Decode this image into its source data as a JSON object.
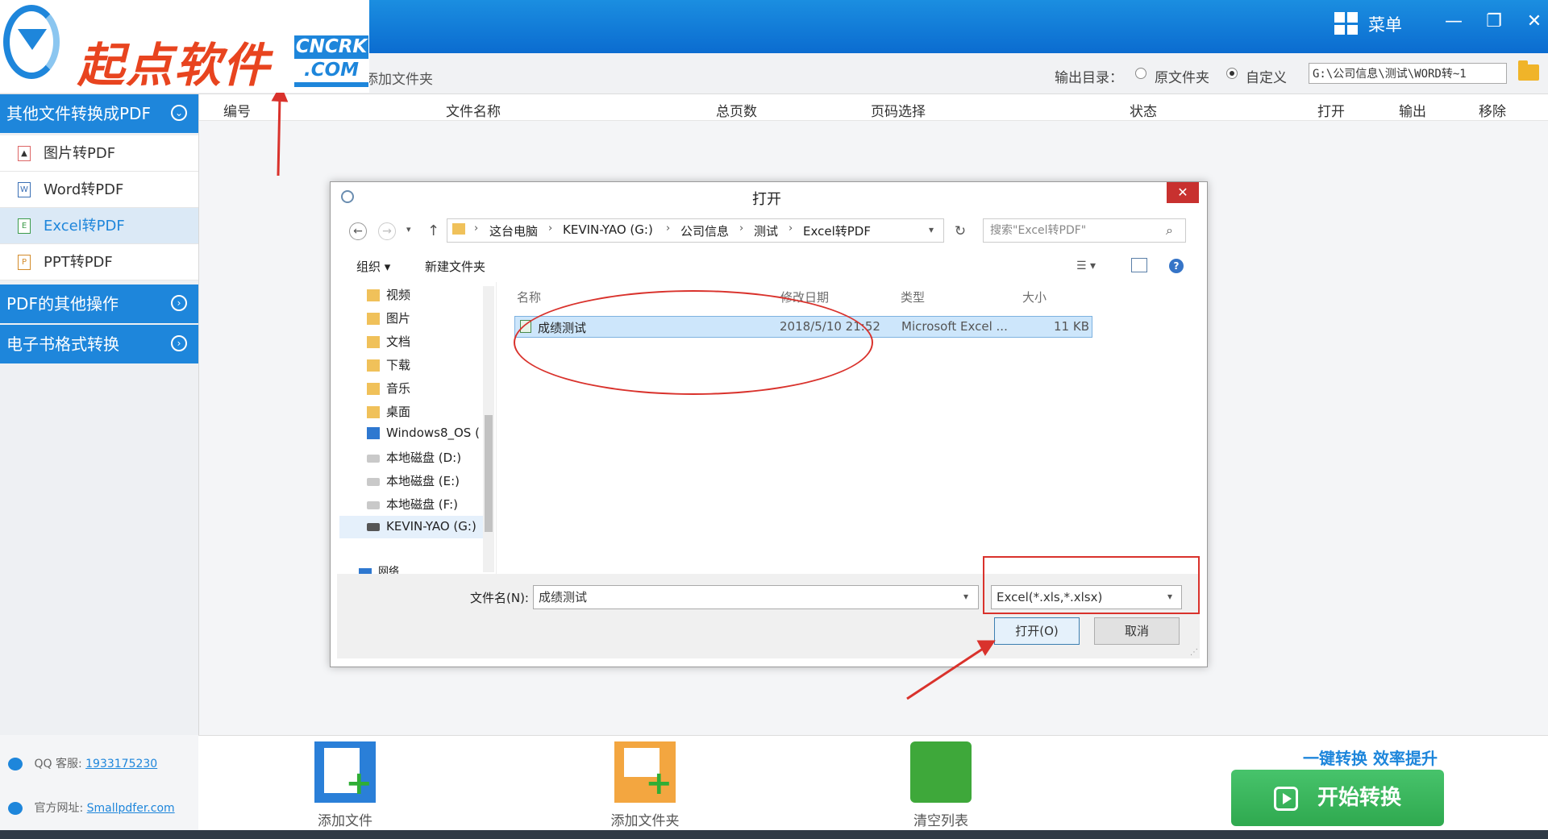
{
  "app": {
    "logo_text": "起点软件",
    "logo_badge_line1": "CNCRK",
    "logo_badge_line2": ".COM",
    "menu_label": "菜单"
  },
  "toolbar": {
    "add_folder": "添加文件夹",
    "output_dir_label": "输出目录：",
    "radio_source": "原文件夹",
    "radio_custom": "自定义",
    "output_path": "G:\\公司信息\\测试\\WORD转~1"
  },
  "table": {
    "columns": [
      "编号",
      "文件名称",
      "总页数",
      "页码选择",
      "状态",
      "打开",
      "输出",
      "移除"
    ]
  },
  "sidebar": {
    "cat1": "其他文件转换成PDF",
    "items": [
      "图片转PDF",
      "Word转PDF",
      "Excel转PDF",
      "PPT转PDF"
    ],
    "cat2": "PDF的其他操作",
    "cat3": "电子书格式转换",
    "qq_label": "QQ 客服:",
    "qq_number": "1933175230",
    "web_label": "官方网址:",
    "web_url": "Smallpdfer.com"
  },
  "bottom": {
    "add_file": "添加文件",
    "add_folder": "添加文件夹",
    "clear_list": "清空列表",
    "slogan": "一键转换  效率提升",
    "start": "开始转换"
  },
  "dialog": {
    "title": "打开",
    "breadcrumb": [
      "这台电脑",
      "KEVIN-YAO (G:)",
      "公司信息",
      "测试",
      "Excel转PDF"
    ],
    "search_placeholder": "搜索\"Excel转PDF\"",
    "organize": "组织 ▾",
    "new_folder": "新建文件夹",
    "nav": [
      "视频",
      "图片",
      "文档",
      "下载",
      "音乐",
      "桌面",
      "Windows8_OS (",
      "本地磁盘 (D:)",
      "本地磁盘 (E:)",
      "本地磁盘 (F:)",
      "KEVIN-YAO (G:)",
      "网络"
    ],
    "col_name": "名称",
    "col_date": "修改日期",
    "col_type": "类型",
    "col_size": "大小",
    "file": {
      "name": "成绩测试",
      "date": "2018/5/10 21:52",
      "type": "Microsoft Excel ...",
      "size": "11 KB"
    },
    "filename_label": "文件名(N):",
    "filename_value": "成绩测试",
    "filter": "Excel(*.xls,*.xlsx)",
    "open": "打开(O)",
    "cancel": "取消"
  },
  "colors": {
    "accent": "#1e86db",
    "annotation": "#d9322c",
    "start_green": "#2fa94f"
  }
}
